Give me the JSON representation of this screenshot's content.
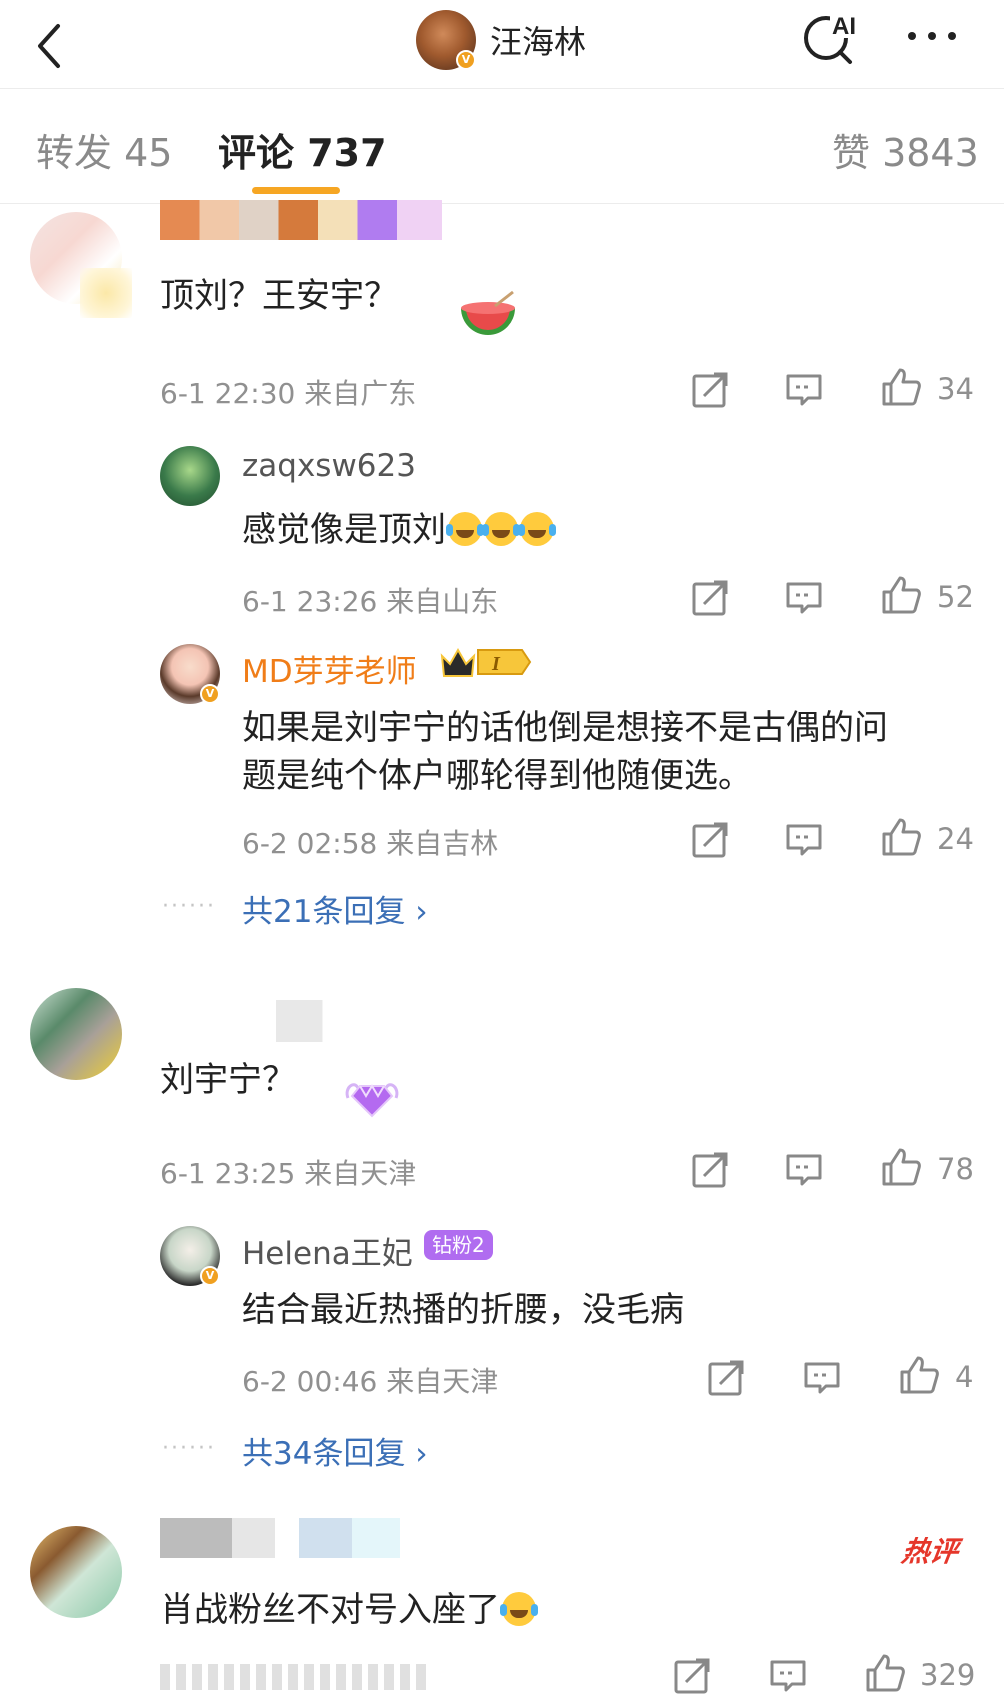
{
  "header": {
    "title": "汪海林",
    "ai_label": "AI"
  },
  "tabs": [
    {
      "label": "转发 45"
    },
    {
      "label": "评论 737"
    },
    {
      "label": "赞 3843"
    }
  ],
  "comments": [
    {
      "text": "顶刘？王安宇？",
      "meta": "6-1 22:30  来自广东",
      "likes": "34",
      "replies": [
        {
          "name": "zaqxsw623",
          "text": "感觉像是顶刘",
          "meta": "6-1 23:26  来自山东",
          "likes": "52"
        },
        {
          "name": "MD芽芽老师",
          "badge": "I",
          "text_line1": "如果是刘宇宁的话他倒是想接不是古偶的问",
          "text_line2": "题是纯个体户哪轮得到他随便选。",
          "meta": "6-2 02:58  来自吉林",
          "likes": "24"
        }
      ],
      "more_replies": "共21条回复 ›"
    },
    {
      "text": "刘宇宁？",
      "meta": "6-1 23:25  来自天津",
      "likes": "78",
      "replies": [
        {
          "name": "Helena王妃",
          "badge": "钻粉2",
          "text": "结合最近热播的折腰，没毛病",
          "meta": "6-2 00:46  来自天津",
          "likes": "4"
        }
      ],
      "more_replies": "共34条回复 ›"
    },
    {
      "text": "肖战粉丝不对号入座了",
      "hot_label": "热评",
      "likes": "329"
    }
  ],
  "ellipsis": "······",
  "colors": {
    "accent": "#f6a623",
    "link": "#3b6fb6",
    "orange_name": "#f07d18",
    "hot": "#e5362a"
  }
}
